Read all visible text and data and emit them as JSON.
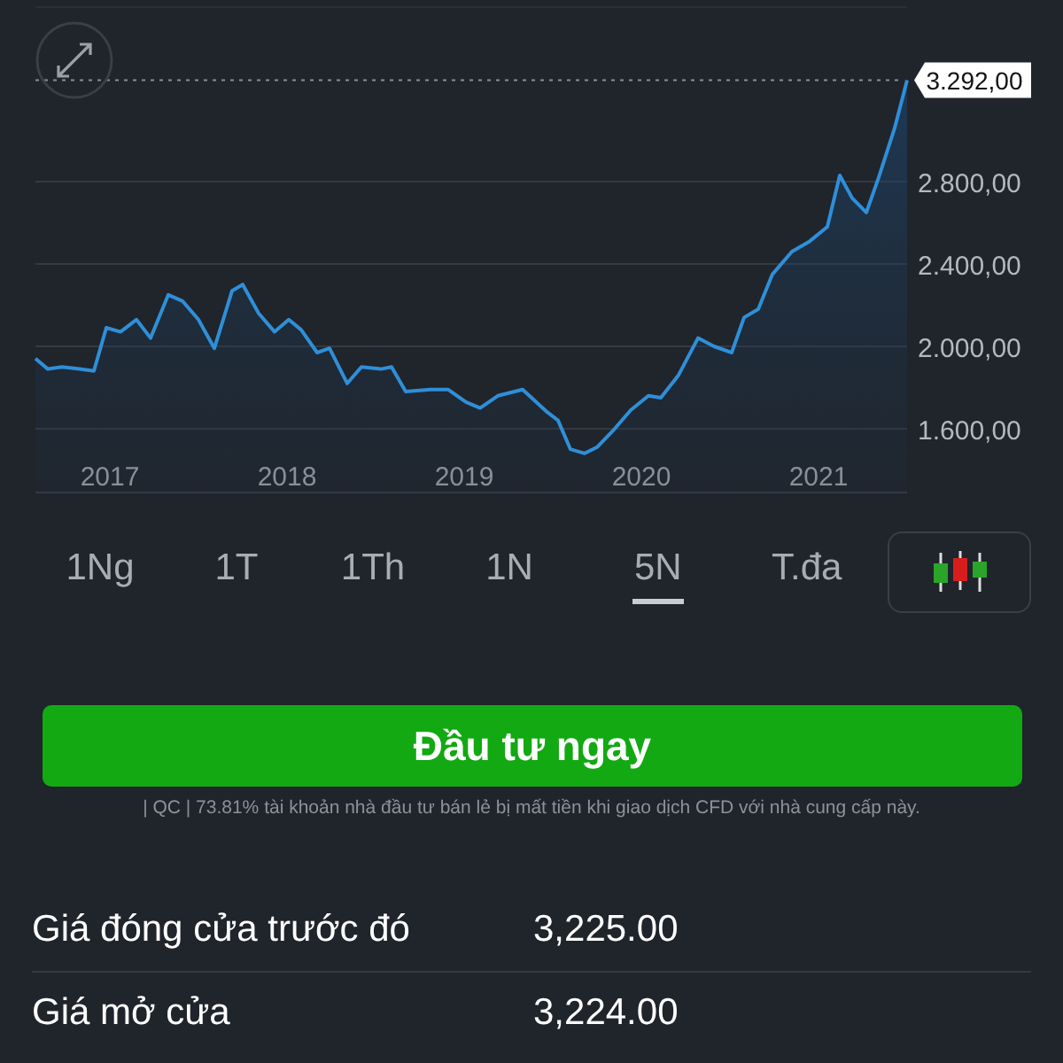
{
  "chart": {
    "chart_data": {
      "type": "area",
      "grid": true,
      "x": [
        2016.58,
        2016.65,
        2016.73,
        2016.83,
        2016.91,
        2016.98,
        2017.06,
        2017.15,
        2017.23,
        2017.33,
        2017.41,
        2017.5,
        2017.59,
        2017.69,
        2017.75,
        2017.84,
        2017.93,
        2018.01,
        2018.08,
        2018.17,
        2018.24,
        2018.34,
        2018.42,
        2018.53,
        2018.59,
        2018.67,
        2018.81,
        2018.91,
        2019.01,
        2019.09,
        2019.19,
        2019.33,
        2019.47,
        2019.53,
        2019.6,
        2019.68,
        2019.75,
        2019.84,
        2019.94,
        2020.04,
        2020.11,
        2020.21,
        2020.32,
        2020.41,
        2020.51,
        2020.58,
        2020.66,
        2020.74,
        2020.85,
        2020.95,
        2021.05,
        2021.12,
        2021.19,
        2021.27,
        2021.34,
        2021.43,
        2021.5
      ],
      "series": [
        {
          "color": "#2f8fd8",
          "values": [
            1940,
            1890,
            1900,
            1890,
            1880,
            2090,
            2070,
            2130,
            2040,
            2250,
            2220,
            2130,
            1990,
            2270,
            2300,
            2160,
            2070,
            2130,
            2080,
            1970,
            1990,
            1820,
            1900,
            1890,
            1900,
            1780,
            1790,
            1790,
            1730,
            1700,
            1760,
            1790,
            1680,
            1640,
            1500,
            1480,
            1510,
            1590,
            1690,
            1760,
            1750,
            1860,
            2040,
            2000,
            1970,
            2140,
            2180,
            2350,
            2460,
            2510,
            2580,
            2830,
            2720,
            2650,
            2820,
            3060,
            3292
          ]
        }
      ],
      "xticks": [
        {
          "value": 2017,
          "label": "2017"
        },
        {
          "value": 2018,
          "label": "2018"
        },
        {
          "value": 2019,
          "label": "2019"
        },
        {
          "value": 2020,
          "label": "2020"
        },
        {
          "value": 2021,
          "label": "2021"
        }
      ],
      "yticks": [
        {
          "value": 1600,
          "label": "1.600,00"
        },
        {
          "value": 2000,
          "label": "2.000,00"
        },
        {
          "value": 2400,
          "label": "2.400,00"
        },
        {
          "value": 2800,
          "label": "2.800,00"
        }
      ],
      "xlim": [
        2016.58,
        2021.5
      ],
      "ylim": [
        1290,
        3647
      ],
      "ref_lines": [
        {
          "axis": "y",
          "value": 3292,
          "label": "3.292,00"
        }
      ]
    }
  },
  "periods": [
    {
      "label": "1Ng",
      "selected": false
    },
    {
      "label": "1T",
      "selected": false
    },
    {
      "label": "1Th",
      "selected": false
    },
    {
      "label": "1N",
      "selected": false
    },
    {
      "label": "5N",
      "selected": true
    },
    {
      "label": "T.đa",
      "selected": false
    }
  ],
  "invest_button": "Đầu tư ngay",
  "disclaimer": "| QC | 73.81% tài khoản nhà đầu tư bán lẻ bị mất tiền khi giao dịch CFD với nhà cung cấp này.",
  "stats": [
    {
      "label": "Giá đóng cửa trước đó",
      "value": "3,225.00"
    },
    {
      "label": "Giá mở cửa",
      "value": "3,224.00"
    }
  ]
}
